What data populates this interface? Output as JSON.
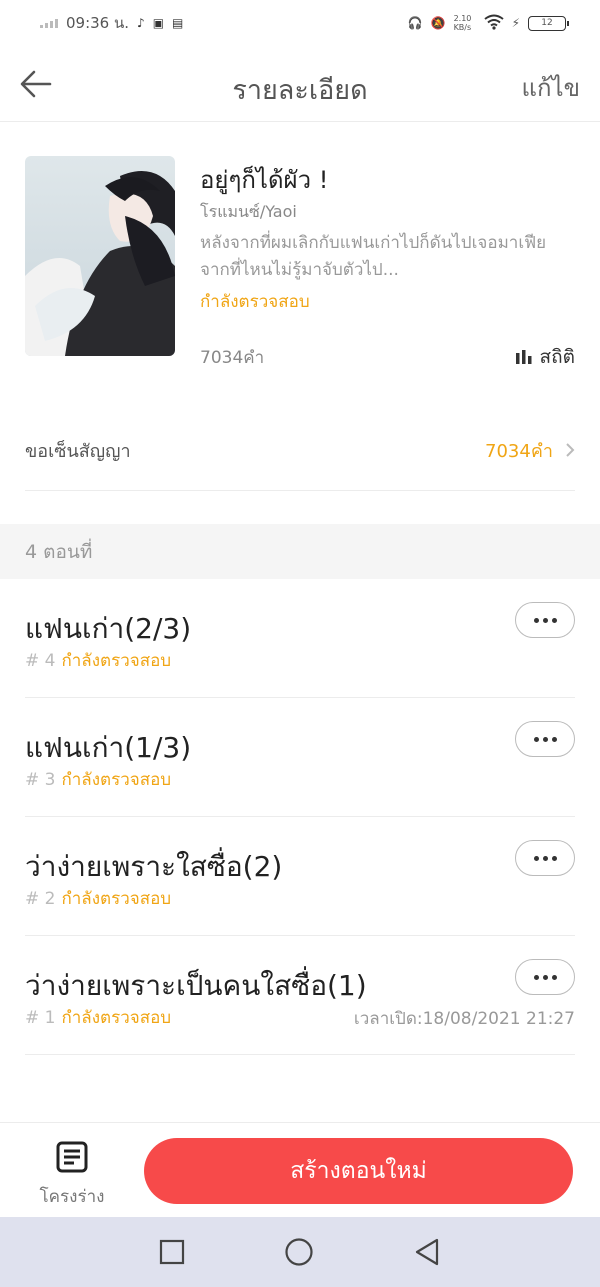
{
  "status_bar": {
    "time": "09:36 น.",
    "net_speed": "2.10 KB/s",
    "battery": "12"
  },
  "header": {
    "title": "รายละเอียด",
    "edit": "แก้ไข"
  },
  "book": {
    "title": "อยู่ๆก็ได้ผัว !",
    "genre": "โรแมนซ์/Yaoi",
    "description": "หลังจากที่ผมเลิกกับแฟนเก่าไปก็ดันไปเจอมาเฟียจากที่ไหนไม่รู้มาจับตัวไป...",
    "status": "กำลังตรวจสอบ",
    "word_count": "7034คำ",
    "stats_label": "สถิติ"
  },
  "contract": {
    "label": "ขอเซ็นสัญญา",
    "value": "7034คำ"
  },
  "chapters_section": {
    "label": "4 ตอนที่"
  },
  "chapters": [
    {
      "title": "แฟนเก่า(2/3)",
      "number": "# 4",
      "status": "กำลังตรวจสอบ",
      "time": ""
    },
    {
      "title": "แฟนเก่า(1/3)",
      "number": "# 3",
      "status": "กำลังตรวจสอบ",
      "time": ""
    },
    {
      "title": "ว่าง่ายเพราะใสซื่อ(2)",
      "number": "# 2",
      "status": "กำลังตรวจสอบ",
      "time": ""
    },
    {
      "title": "ว่าง่ายเพราะเป็นคนใสซื่อ(1)",
      "number": "# 1",
      "status": "กำลังตรวจสอบ",
      "time": "เวลาเปิด:18/08/2021 21:27"
    }
  ],
  "bottom": {
    "outline": "โครงร่าง",
    "create": "สร้างตอนใหม่"
  },
  "colors": {
    "accent_orange": "#f0a515",
    "primary_red": "#f74a4a",
    "nav_bg": "#dfe1ee"
  }
}
